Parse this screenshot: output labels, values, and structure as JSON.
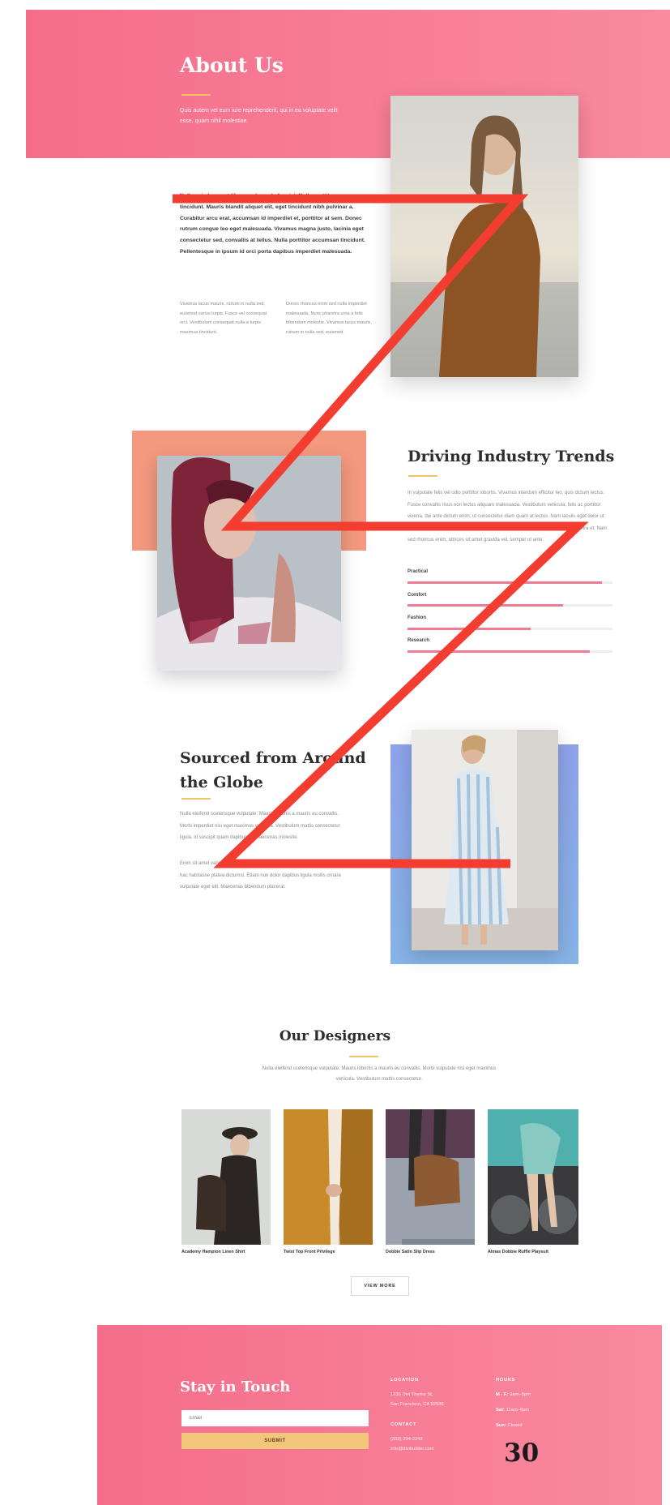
{
  "hero": {
    "title": "About Us",
    "subtitle": "Quis autem vel eum iure reprehenderit, qui in ea voluptate velit esse, quam nihil molestiae."
  },
  "intro": {
    "bold_text": "Nulla quis lorem ut libero malesuada feugiat. Nulla porttitor accumsan tincidunt. Mauris blandit aliquet elit, eget tincidunt nibh pulvinar a. Curabitur arcu erat, accumsan id imperdiet et, porttitor at sem. Donec rutrum congue leo eget malesuada. Vivamus magna justo, lacinia eget consectetur sed, convallis at tellus. Nulla porttitor accumsan tincidunt. Pellentesque in ipsum id orci porta dapibus imperdiet malesuada.",
    "col_left": "Vivamus lacus mauris, rutrum in nulla sed, euismod varius turpis. Fusce vel consequat orci. Vestibulum consequat nulla a turpis maximus tincidunt.",
    "col_right": "Donec rhoncus enim sed nulla imperdiet malesuada. Nunc pharetra urna a felis bibendum molestie. Vivamus lacus mauris, rutrum in nulla sed, euismod."
  },
  "trends": {
    "title": "Driving Industry Trends",
    "text": "In vulputate felis vel odio porttitor lobortis. Vivamus interdum efficitur leo, quis dictum lectus. Fusce convallis risus non lectus aliquam malesuada. Vestibulum vehicula, felis ac porttitor viverra, dui ante dictum enim, ut consectetur diam quam at lectus. Nam iaculis eget dolor ut sagittis. Sed eget sem purus. Vestibulum maximus dolor, eget finibus lorem pharetra et. Nam sed rhoncus enim, ultrices sit amet gravida vel, semper ut ante.",
    "skills": [
      {
        "label": "Practical",
        "value": 0.95
      },
      {
        "label": "Comfort",
        "value": 0.76
      },
      {
        "label": "Fashion",
        "value": 0.6
      },
      {
        "label": "Research",
        "value": 0.89
      }
    ]
  },
  "sourced": {
    "title_line1": "Sourced from Around",
    "title_line2": "the Globe",
    "para1": "Nulla eleifend scelerisque vulputate. Mauris lobortis a mauris eu convallis. Morbi imperdiet nisi eget maximus vehicula. Vestibulum mattis consectetur ligula, id suscipit quam dapibus id. Maecenas molestie.",
    "para2": "Enim sit amet varius pellentesque. Nullam quis finibus sapien eros et est. In hac habitasse platea dictumst. Etiam non dolor dapibus ligula mollis ornare vulputate eget elit. Maecenas bibendum placerat."
  },
  "designers": {
    "title": "Our Designers",
    "subtitle": "Nulla eleifend scelerisque vulputate. Mauris lobortis a mauris eu convallis. Morbi vulputate nisi eget maximus vehicula. Vestibulum mattis consectetur.",
    "items": [
      {
        "name": "Academy Hampton Linen Shirt"
      },
      {
        "name": "Twist Top Front Privilege"
      },
      {
        "name": "Dobbie Satin Slip Dress"
      },
      {
        "name": "Almas Dobbie Ruffle Playsuit"
      }
    ],
    "view_more": "VIEW MORE"
  },
  "footer": {
    "title": "Stay in Touch",
    "email_placeholder": "Email",
    "submit": "SUBMIT",
    "location_head": "LOCATION",
    "location_line1": "1235 Divi Theme St,",
    "location_line2": "San Francisco, CA 92536",
    "contact_head": "CONTACT",
    "phone": "(333) 294-2242",
    "email": "info@divibuilder.com",
    "hours_head": "HOURS",
    "hours": [
      {
        "day": "M - F:",
        "time": "9am–6pm"
      },
      {
        "day": "Sat:",
        "time": "11am–6pm"
      },
      {
        "day": "Sun:",
        "time": "Closed"
      }
    ]
  },
  "page_number": "30",
  "colors": {
    "brand_pink": "#f56d8a",
    "accent_gold": "#f5c46a",
    "salmon_block": "#f4997f",
    "blue_block": "#8fa8ea",
    "zigzag_red": "#f23d30"
  }
}
